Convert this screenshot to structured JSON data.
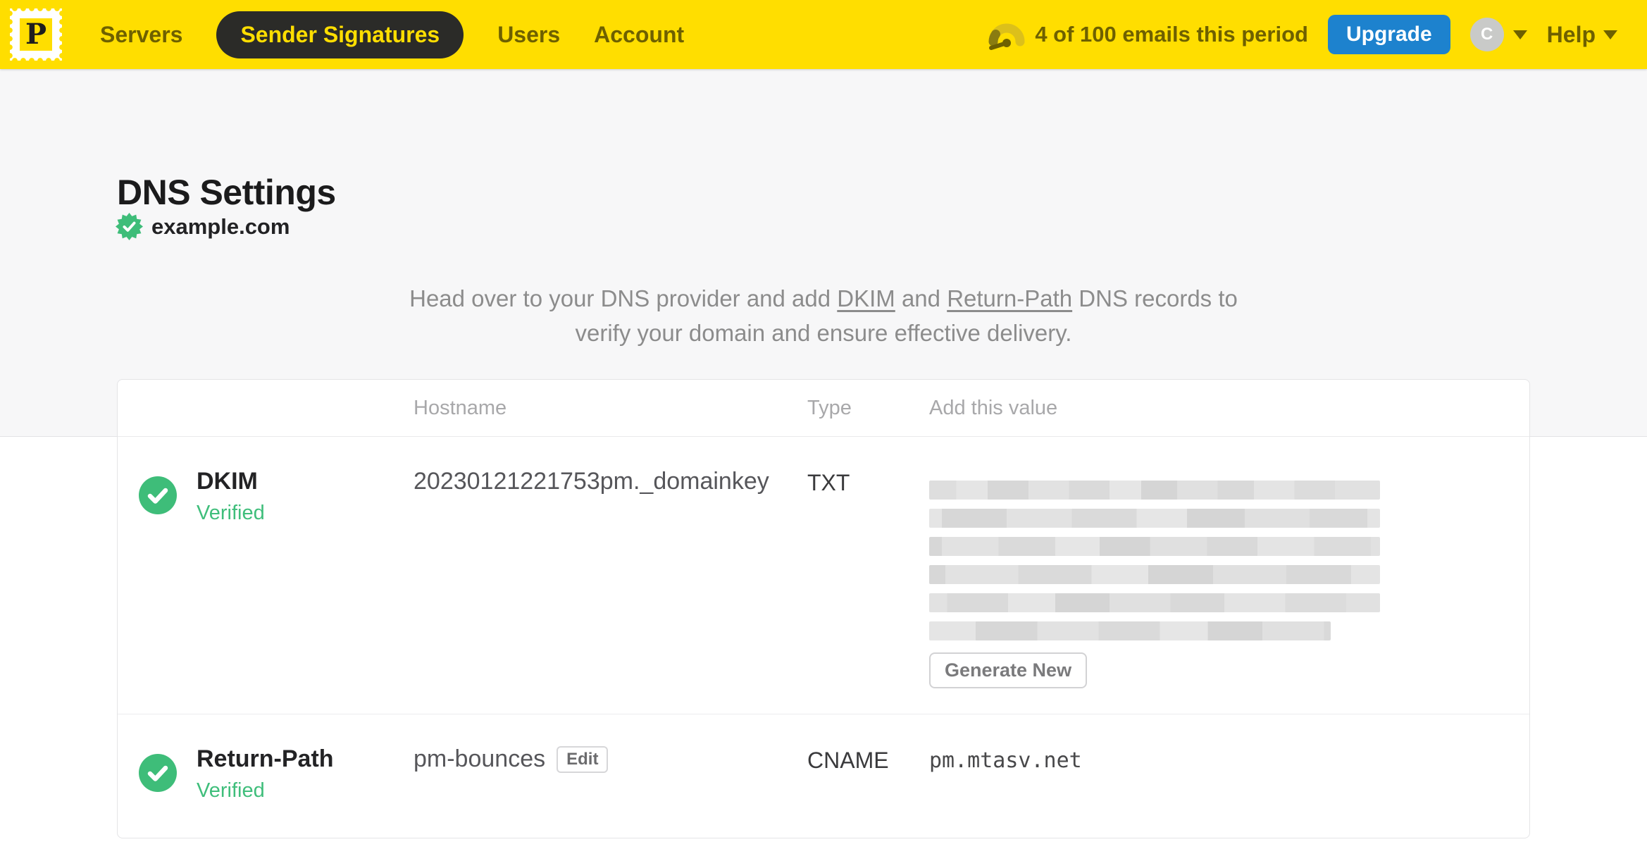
{
  "nav": {
    "logo_letter": "P",
    "items": [
      {
        "label": "Servers",
        "active": false
      },
      {
        "label": "Sender Signatures",
        "active": true
      },
      {
        "label": "Users",
        "active": false
      },
      {
        "label": "Account",
        "active": false
      }
    ],
    "usage_text": "4 of 100 emails this period",
    "upgrade_label": "Upgrade",
    "avatar_initial": "C",
    "help_label": "Help"
  },
  "page": {
    "title": "DNS Settings",
    "domain": "example.com",
    "domain_status": "verified",
    "instruction": {
      "pre": "Head over to your DNS provider and add ",
      "link_dkim": "DKIM",
      "between": " and ",
      "link_return_path": "Return-Path",
      "post": " DNS records to",
      "line2": "verify your domain and ensure effective delivery."
    }
  },
  "table": {
    "headers": {
      "hostname": "Hostname",
      "type": "Type",
      "value": "Add this value"
    },
    "rows": [
      {
        "name": "DKIM",
        "status": "Verified",
        "hostname": "20230121221753pm._domainkey",
        "type": "TXT",
        "value": "(redacted)",
        "redacted_bars": [
          100,
          100,
          100,
          100,
          100,
          89
        ],
        "action_label": "Generate New"
      },
      {
        "name": "Return-Path",
        "status": "Verified",
        "hostname": "pm-bounces",
        "edit_label": "Edit",
        "type": "CNAME",
        "value": "pm.mtasv.net"
      }
    ]
  },
  "colors": {
    "brand_yellow": "#FFDE00",
    "nav_text": "#6E6000",
    "active_pill": "#2B2B28",
    "upgrade_blue": "#1D82CE",
    "verified_green": "#3FBE7B",
    "instruction_gray": "#8C8C8C"
  }
}
